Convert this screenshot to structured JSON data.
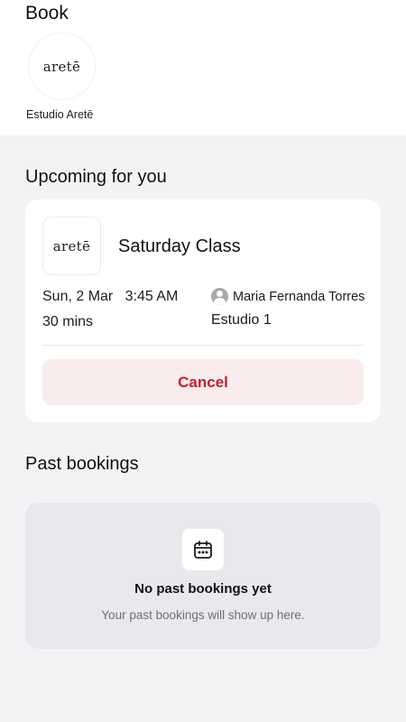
{
  "header": {
    "title": "Book"
  },
  "studio": {
    "logo_text": "aretē",
    "name": "Estudio Aretē"
  },
  "upcoming": {
    "section_title": "Upcoming for you",
    "booking": {
      "logo_text": "aretē",
      "class_name": "Saturday Class",
      "date_time": "Sun, 2 Mar   3:45 AM",
      "duration": "30 mins",
      "instructor_icon": "user-avatar-icon",
      "instructor": "Maria Fernanda Torres",
      "room": "Estudio 1",
      "cancel_label": "Cancel"
    }
  },
  "past": {
    "section_title": "Past bookings",
    "empty_icon": "calendar-icon",
    "empty_title": "No past bookings yet",
    "empty_subtitle": "Your past bookings will show up here."
  },
  "colors": {
    "cancel_text": "#c41f30",
    "cancel_bg": "#f9ecec",
    "page_bg": "#f3f3f5"
  }
}
